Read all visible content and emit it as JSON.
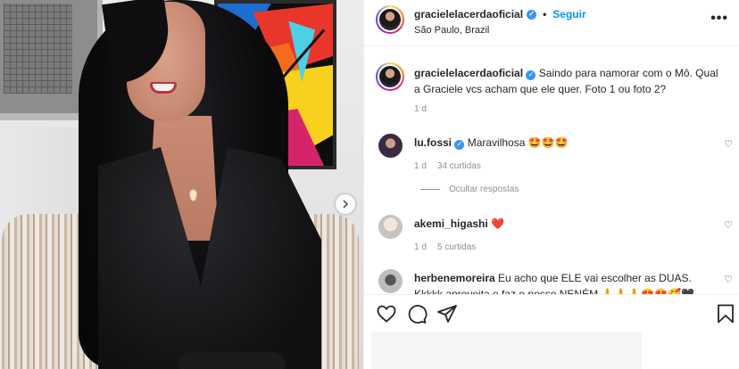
{
  "post": {
    "username": "gracielelacerdaoficial",
    "follow_label": "Seguir",
    "location": "São Paulo, Brazil",
    "more_label": "•••"
  },
  "caption": {
    "username": "gracielelacerdaoficial",
    "text": "Saindo para namorar com o Mô. Qual a Graciele vcs acham que ele quer. Foto 1 ou foto 2?",
    "time": "1 d"
  },
  "comments": [
    {
      "username": "lu.fossi",
      "verified": true,
      "text": "Maravilhosa 🤩🤩🤩",
      "time": "1 d",
      "likes": "34 curtidas"
    },
    {
      "username": "akemi_higashi",
      "verified": false,
      "text": "❤️",
      "time": "1 d",
      "likes": "5 curtidas"
    },
    {
      "username": "herbenemoreira",
      "verified": false,
      "text": "Eu acho que ELE vai escolher as DUAS. Kkkkk aproveita e faz o nosso NENÉM 🙏🙏🙏😍😍🥰🖤",
      "time": "",
      "likes": ""
    }
  ],
  "hide_replies_label": "Ocultar respostas",
  "icons": {
    "verified": "verified-badge-icon",
    "next": "chevron-right-icon",
    "like": "heart-icon",
    "comment": "comment-bubble-icon",
    "share": "paper-plane-icon",
    "save": "bookmark-icon"
  },
  "colors": {
    "link_blue": "#0095f6",
    "verified_blue": "#3897f0",
    "muted": "#8e8e8e",
    "text": "#262626"
  }
}
